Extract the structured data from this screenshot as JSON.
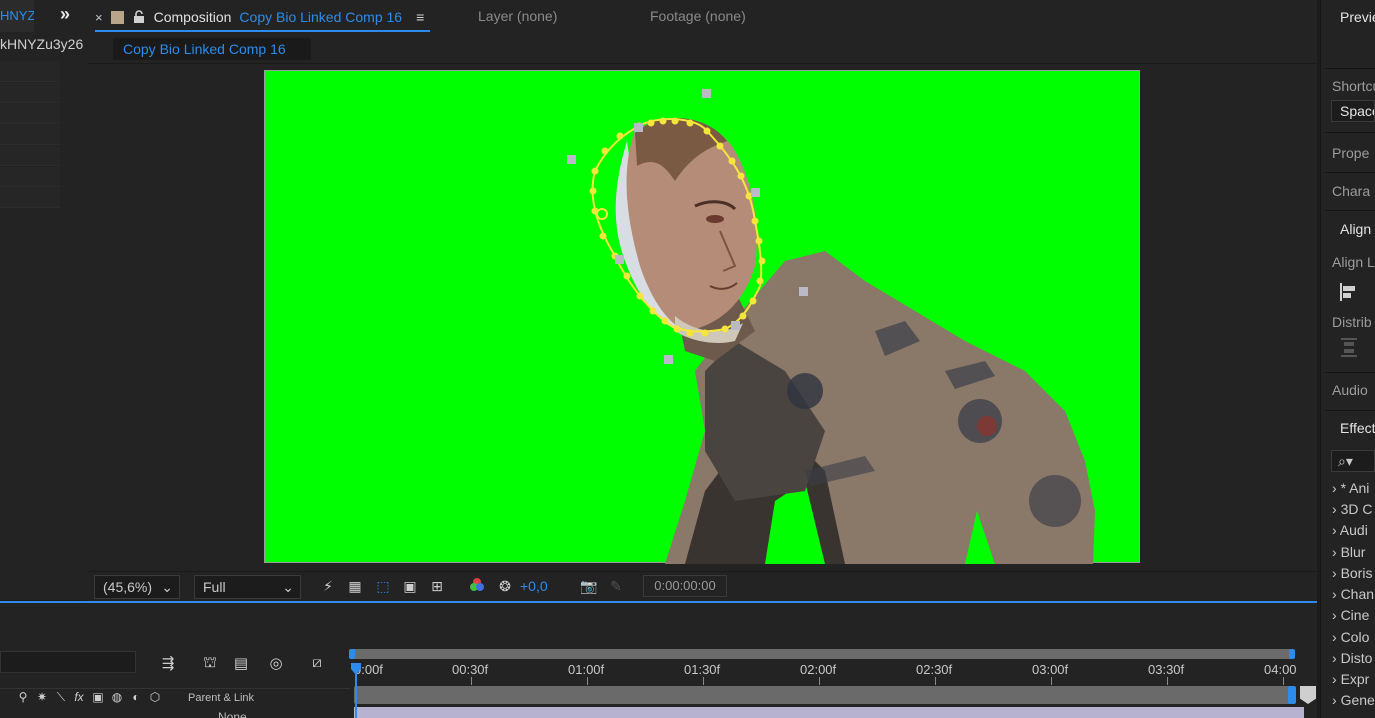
{
  "left_panel": {
    "tab_label": "HNYZ",
    "expand_label": "»",
    "item_name": "kHNYZu3y26"
  },
  "viewer": {
    "close_label": "×",
    "comp_tab_prefix": "Composition",
    "comp_tab_name": "Copy Bio Linked Comp 16",
    "menu_label": "≡",
    "layer_tab": "Layer  (none)",
    "footage_tab": "Footage  (none)",
    "breadcrumb": "Copy Bio Linked Comp 16",
    "zoom": "(45,6%)",
    "resolution": "Full",
    "exposure": "+0,0",
    "timecode": "0:00:00:00"
  },
  "right_panel": {
    "preview": "Previe",
    "shortcut_label": "Shortcu",
    "shortcut_value": "Space",
    "properties": "Prope",
    "character": "Chara",
    "align": "Align",
    "align_layers": "Align L",
    "distribute": "Distrib",
    "audio": "Audio",
    "effects": "Effect",
    "search_icon": "magnifier-icon",
    "effect_items": [
      "* Ani",
      "3D C",
      "Audi",
      "Blur",
      "Boris",
      "Chan",
      "Cine",
      "Colo",
      "Disto",
      "Expr",
      "Gene"
    ]
  },
  "timeline": {
    "parent_link": "Parent & Link",
    "parent_value": "None",
    "time_labels": [
      "0:00f",
      "00:30f",
      "01:00f",
      "01:30f",
      "02:00f",
      "02:30f",
      "03:00f",
      "03:30f",
      "04:00"
    ]
  },
  "colors": {
    "accent": "#2d8ceb",
    "green_screen": "#00ff00",
    "mask": "#f5e63a",
    "panel": "#232323"
  }
}
